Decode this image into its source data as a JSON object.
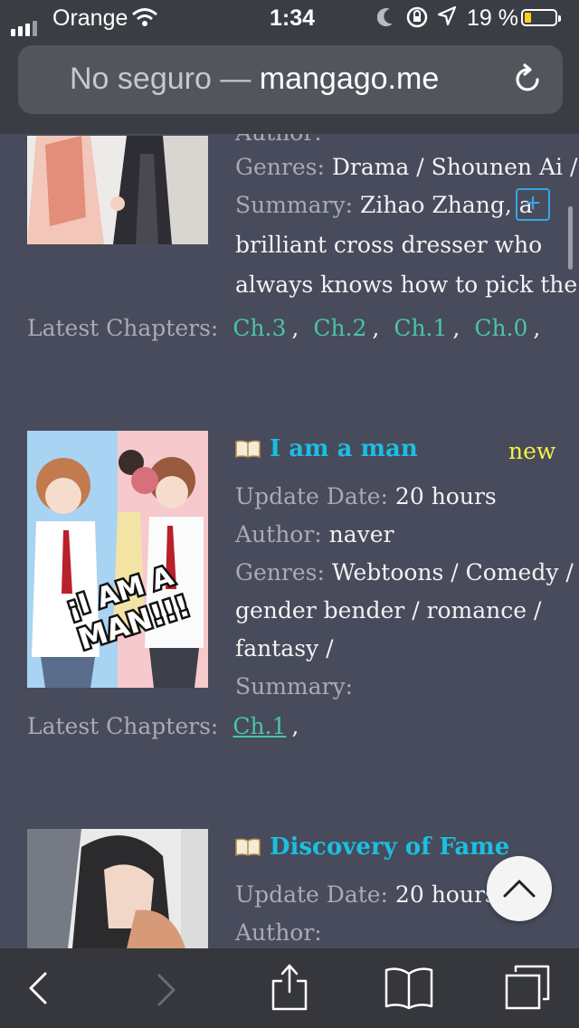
{
  "status_bar": {
    "carrier": "Orange",
    "time": "1:34",
    "battery_percent": "19 %",
    "battery_level": 0.19,
    "battery_color": "#f4d21e"
  },
  "url_bar": {
    "security_text": "No seguro",
    "separator": " — ",
    "domain": "mangago.me",
    "reload_icon": "reload-icon"
  },
  "manga": [
    {
      "genres_label": "Genres:",
      "genres": " Drama / Shounen Ai /",
      "summary_label": "Summary:",
      "summary_lines": [
        " Zihao Zhang, a",
        "brilliant cross dresser who",
        "always knows how to pick the"
      ],
      "latest_label": "Latest Chapters:",
      "chapters": [
        "Ch.3",
        "Ch.2",
        "Ch.1",
        "Ch.0"
      ],
      "expand_label": "+"
    },
    {
      "title": "I am a man",
      "badge": "new",
      "update_label": "Update Date:",
      "update_value": " 20 hours",
      "author_label": "Author:",
      "author_value": " naver",
      "genres_label": "Genres:",
      "genres_lines": [
        " Webtoons / Comedy /",
        "gender bender / romance /",
        "fantasy /"
      ],
      "summary_label": "Summary:",
      "latest_label": "Latest Chapters:",
      "chapters": [
        "Ch.1"
      ],
      "cover_text": "¡I AM A MAN!!!"
    },
    {
      "title": "Discovery of Fame",
      "update_label": "Update Date:",
      "update_value": " 20 hours",
      "author_label": "Author:"
    }
  ],
  "colors": {
    "background": "#474b5c",
    "title": "#1bbfe0",
    "chapter_link": "#49c5a7",
    "badge": "#f5f046"
  },
  "toolbar": {
    "back_icon": "chevron-left-icon",
    "forward_icon": "chevron-right-icon",
    "share_icon": "share-icon",
    "bookmarks_icon": "book-open-icon",
    "tabs_icon": "tabs-icon"
  },
  "scroll_to_top_icon": "chevron-up-icon"
}
